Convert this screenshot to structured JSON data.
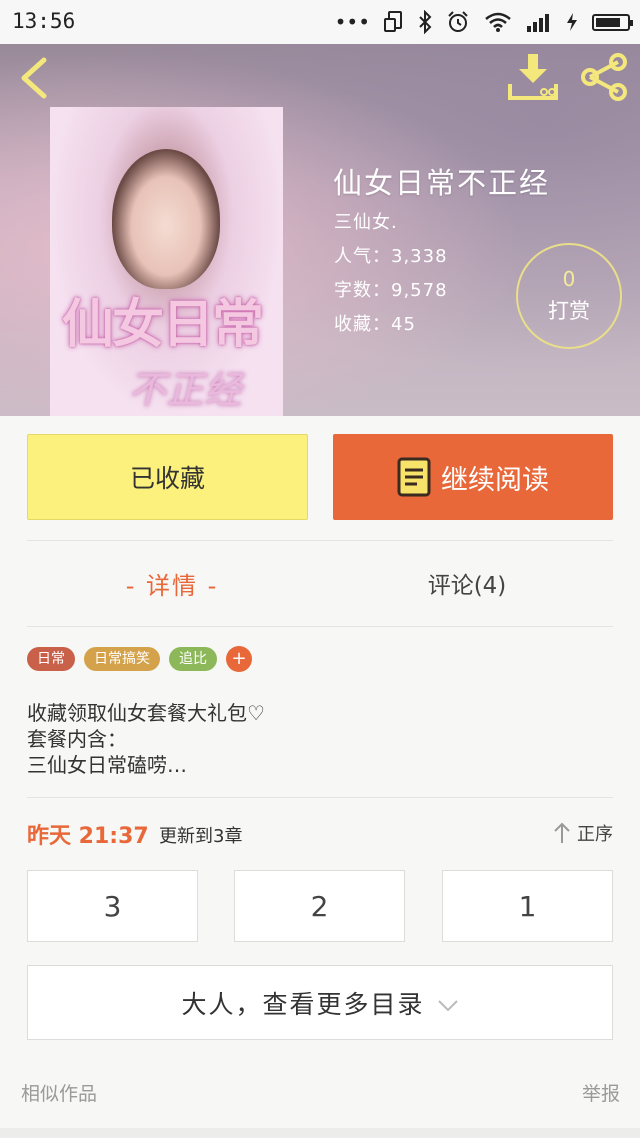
{
  "status_bar": {
    "time": "13:56",
    "icons": [
      "more-dots-icon",
      "screen-rotate-icon",
      "bluetooth-icon",
      "alarm-icon",
      "wifi-icon",
      "signal-icon",
      "charging-icon",
      "battery-icon"
    ]
  },
  "header": {
    "back_icon": "chevron-left-icon",
    "download_icon": "download-icon",
    "share_icon": "share-icon"
  },
  "book": {
    "cover_title_line1": "仙女日常",
    "cover_title_line2": "不正经",
    "title": "仙女日常不正经",
    "author": "三仙女.",
    "popularity": "人气：3,338",
    "word_count": "字数：9,578",
    "favorites": "收藏：45",
    "tip_count": "0",
    "tip_label": "打赏"
  },
  "actions": {
    "favorited_label": "已收藏",
    "continue_label": "继续阅读"
  },
  "tabs": {
    "detail": "- 详情 -",
    "comments": "评论(4)"
  },
  "tags": [
    {
      "label": "日常",
      "color": "#c9614a"
    },
    {
      "label": "日常搞笑",
      "color": "#d4a24a"
    },
    {
      "label": "追比",
      "color": "#8cb85a"
    }
  ],
  "tag_add": {
    "label": "+",
    "color": "#e8683a"
  },
  "description": {
    "line1": "收藏领取仙女套餐大礼包♡",
    "line2": "套餐内含：",
    "line3": "三仙女日常磕唠…"
  },
  "update": {
    "time": "昨天 21:37",
    "text": "更新到3章",
    "order_label": "正序"
  },
  "chapters": [
    "3",
    "2",
    "1"
  ],
  "more_catalog": "大人，查看更多目录",
  "footer": {
    "similar": "相似作品",
    "report": "举报"
  },
  "colors": {
    "accent_orange": "#e8683a",
    "fav_yellow": "#fbf17c",
    "tip_ring": "#e9de8a"
  }
}
